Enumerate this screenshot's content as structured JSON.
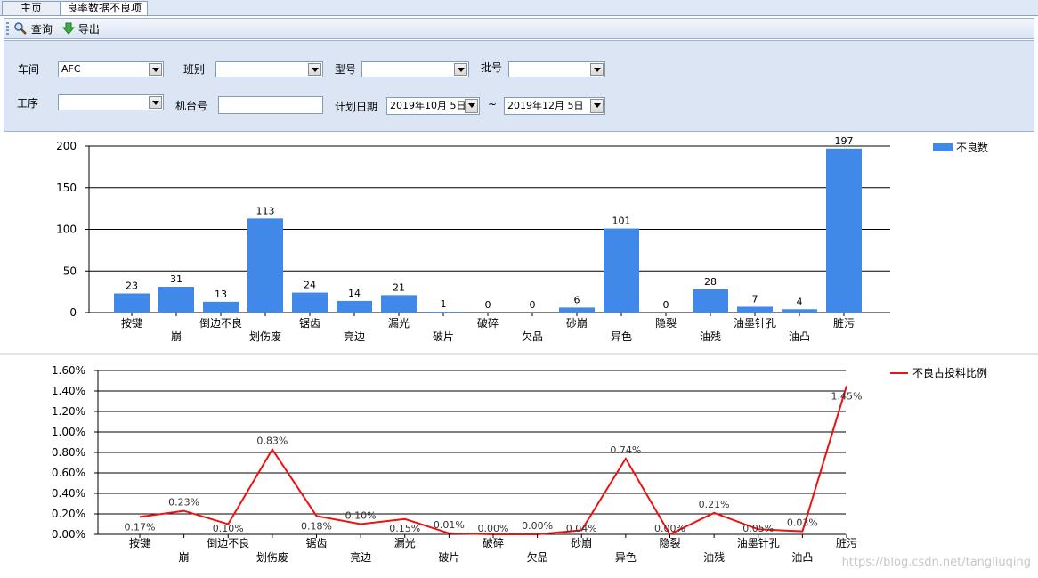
{
  "tabs": [
    {
      "label": "主页"
    },
    {
      "label": "良率数据不良项"
    }
  ],
  "toolbar": {
    "query_label": "查询",
    "export_label": "导出"
  },
  "filters": {
    "workshop_label": "车间",
    "workshop_value": "AFC",
    "shift_label": "班别",
    "shift_value": "",
    "model_label": "型号",
    "model_value": "",
    "batch_label": "批号",
    "batch_value": "",
    "process_label": "工序",
    "process_value": "",
    "machine_label": "机台号",
    "machine_value": "",
    "plan_date_label": "计划日期",
    "date_from": "2019年10月 5日",
    "date_sep": "~",
    "date_to": "2019年12月 5日"
  },
  "watermark": "https://blog.csdn.net/tangliuqing",
  "chart_data": [
    {
      "type": "bar",
      "categories": [
        "按键",
        "崩",
        "倒边不良",
        "划伤废",
        "锯齿",
        "亮边",
        "漏光",
        "破片",
        "破碎",
        "欠品",
        "砂崩",
        "异色",
        "隐裂",
        "油残",
        "油墨针孔",
        "油凸",
        "脏污"
      ],
      "series": [
        {
          "name": "不良数",
          "values": [
            23,
            31,
            13,
            113,
            24,
            14,
            21,
            1,
            0,
            0,
            6,
            101,
            0,
            28,
            7,
            4,
            197
          ],
          "color": "#4189e8"
        }
      ],
      "ylim": [
        0,
        200
      ],
      "yticks": [
        "0",
        "50",
        "100",
        "150",
        "200"
      ],
      "grid": true,
      "legend": "top-right"
    },
    {
      "type": "line",
      "categories": [
        "按键",
        "崩",
        "倒边不良",
        "划伤废",
        "锯齿",
        "亮边",
        "漏光",
        "破片",
        "破碎",
        "欠品",
        "砂崩",
        "异色",
        "隐裂",
        "油残",
        "油墨针孔",
        "油凸",
        "脏污"
      ],
      "series": [
        {
          "name": "不良占投料比例",
          "values": [
            0.17,
            0.23,
            0.1,
            0.83,
            0.18,
            0.1,
            0.15,
            0.01,
            0.0,
            0.0,
            0.04,
            0.74,
            0.0,
            0.21,
            0.05,
            0.03,
            1.45
          ],
          "color": "#ee1111"
        }
      ],
      "data_labels": [
        "0.17%",
        "0.23%",
        "0.10%",
        "0.83%",
        "0.18%",
        "0.10%",
        "0.15%",
        "0.01%",
        "0.00%",
        "0.00%",
        "0.04%",
        "0.74%",
        "0.00%",
        "0.21%",
        "0.05%",
        "0.03%",
        "1.45%"
      ],
      "ylim": [
        0,
        1.6
      ],
      "yticks": [
        "0.00%",
        "0.20%",
        "0.40%",
        "0.60%",
        "0.80%",
        "1.00%",
        "1.20%",
        "1.40%",
        "1.60%"
      ],
      "grid": true,
      "legend": "top-right"
    }
  ]
}
